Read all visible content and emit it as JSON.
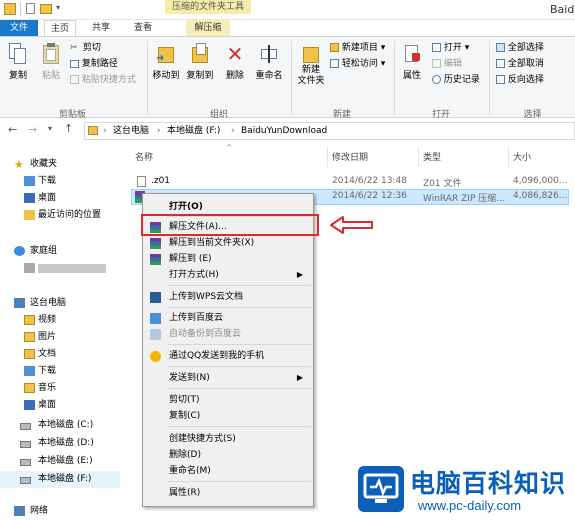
{
  "titlebar": {
    "context_label": "压缩的文件夹工具",
    "title": "Baid"
  },
  "tabs": {
    "file": "文件",
    "home": "主页",
    "share": "共享",
    "view": "查看",
    "extract": "解压缩"
  },
  "ribbon": {
    "clipboard": {
      "copy": "复制",
      "paste": "粘贴",
      "cut": "剪切",
      "copy_path": "复制路径",
      "paste_shortcut": "粘贴快捷方式",
      "group": "剪贴板"
    },
    "organize": {
      "move_to": "移动到",
      "copy_to": "复制到",
      "delete": "删除",
      "rename": "重命名",
      "group": "组织"
    },
    "new": {
      "new_folder_1": "新建",
      "new_folder_2": "文件夹",
      "new_item": "新建项目",
      "easy_access": "轻松访问",
      "group": "新建"
    },
    "open": {
      "properties": "属性",
      "open": "打开",
      "edit": "编辑",
      "history": "历史记录",
      "group": "打开"
    },
    "select": {
      "select_all": "全部选择",
      "select_none": "全部取消",
      "invert": "反向选择",
      "group": "选择"
    }
  },
  "address": {
    "computer": "这台电脑",
    "drive": "本地磁盘 (F:)",
    "folder": "BaiduYunDownload"
  },
  "nav": {
    "favorites": "收藏夹",
    "downloads": "下载",
    "desktop": "桌面",
    "recent": "最近访问的位置",
    "homegroup": "家庭组",
    "this_pc": "这台电脑",
    "videos": "视频",
    "pictures": "图片",
    "documents": "文档",
    "downloads2": "下载",
    "music": "音乐",
    "desktop2": "桌面",
    "disk_c": "本地磁盘 (C:)",
    "disk_d": "本地磁盘 (D:)",
    "disk_e": "本地磁盘 (E:)",
    "disk_f": "本地磁盘 (F:)",
    "network": "网络"
  },
  "columns": {
    "name": "名称",
    "modified": "修改日期",
    "type": "类型",
    "size": "大小"
  },
  "files": [
    {
      "name": ".z01",
      "modified": "2014/6/22 13:48",
      "type": "Z01 文件",
      "size": "4,096,000..."
    },
    {
      "name": "",
      "modified": "2014/6/22 12:36",
      "type": "WinRAR ZIP 压缩...",
      "size": "4,086,826..."
    }
  ],
  "menu": {
    "open": "打开(O)",
    "extract_files": "解压文件(A)...",
    "extract_here": "解压到当前文件夹(X)",
    "extract_to": "解压到 (E)",
    "open_with": "打开方式(H)",
    "upload_wps": "上传到WPS云文档",
    "upload_baidu": "上传到百度云",
    "auto_backup": "自动备份到百度云",
    "send_qq": "通过QQ发送到我的手机",
    "send_to": "发送到(N)",
    "cut": "剪切(T)",
    "copy": "复制(C)",
    "create_shortcut": "创建快捷方式(S)",
    "delete": "删除(D)",
    "rename": "重命名(M)",
    "properties": "属性(R)"
  },
  "watermark": {
    "brand": "电脑百科知识",
    "url": "www.pc-daily.com"
  },
  "colors": {
    "accent": "#1979ca",
    "selection": "#cce8ff",
    "highlight": "#e0282e",
    "context_tab": "#f5eca9"
  }
}
